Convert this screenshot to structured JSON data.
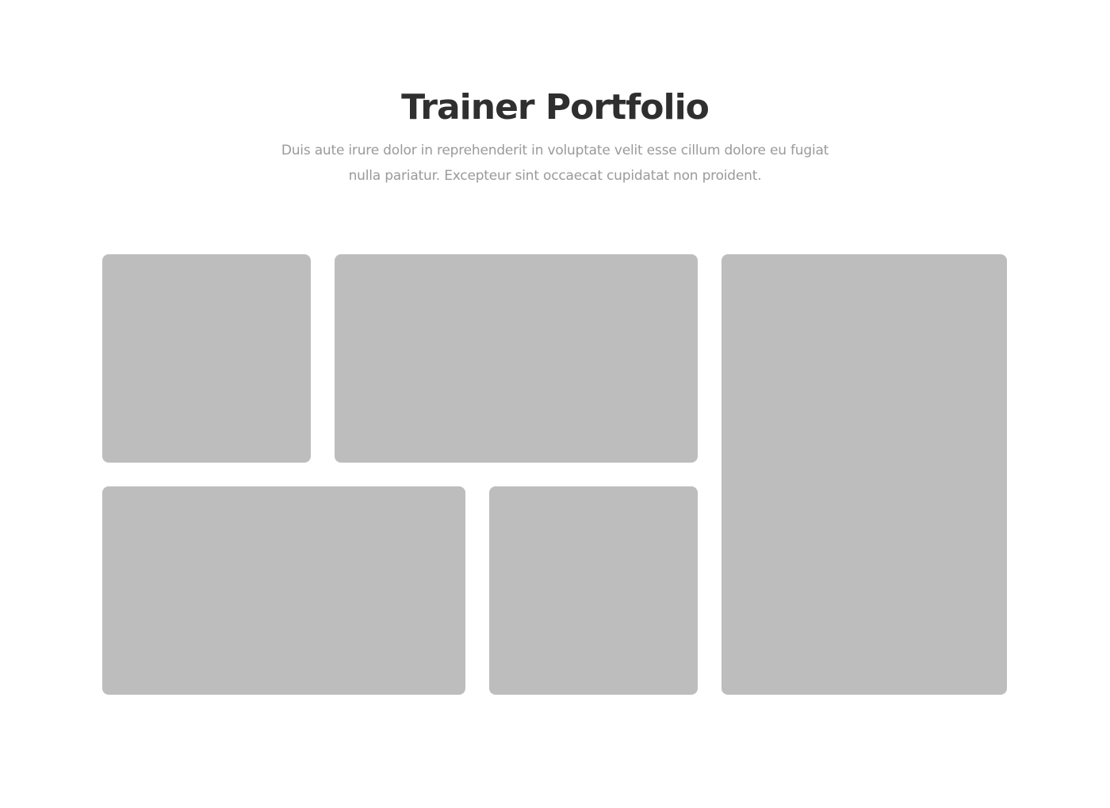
{
  "header": {
    "title": "Trainer Portfolio",
    "subtitle": "Duis aute irure dolor in reprehenderit in voluptate velit esse cillum dolore eu fugiat nulla pariatur. Excepteur sint occaecat cupidatat non proident."
  },
  "portfolio": {
    "tile_color": "#bdbdbd"
  }
}
